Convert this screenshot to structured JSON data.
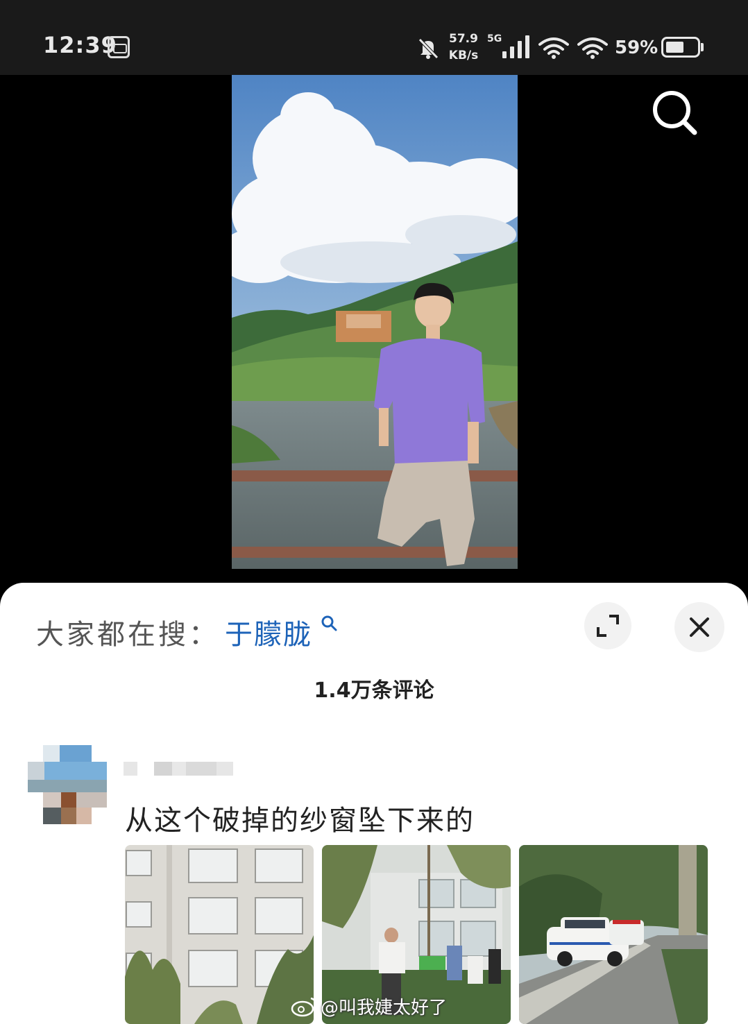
{
  "status_bar": {
    "time": "12:39",
    "net_speed_value": "57.9",
    "net_speed_unit": "KB/s",
    "network_gen": "5G",
    "battery_percent": "59%",
    "battery_level": 0.59
  },
  "bottom_sheet": {
    "trending_label": "大家都在搜：",
    "trending_keyword": "于朦胧",
    "comment_count": "1.4万条评论"
  },
  "comment": {
    "text": "从这个破掉的纱窗坠下来的"
  },
  "watermark": {
    "text": "@叫我婕太好了"
  },
  "colors": {
    "status_bar_bg": "#1a1a1a",
    "keyword_blue": "#1d63b8",
    "shirt_purple": "#8f78d8"
  }
}
